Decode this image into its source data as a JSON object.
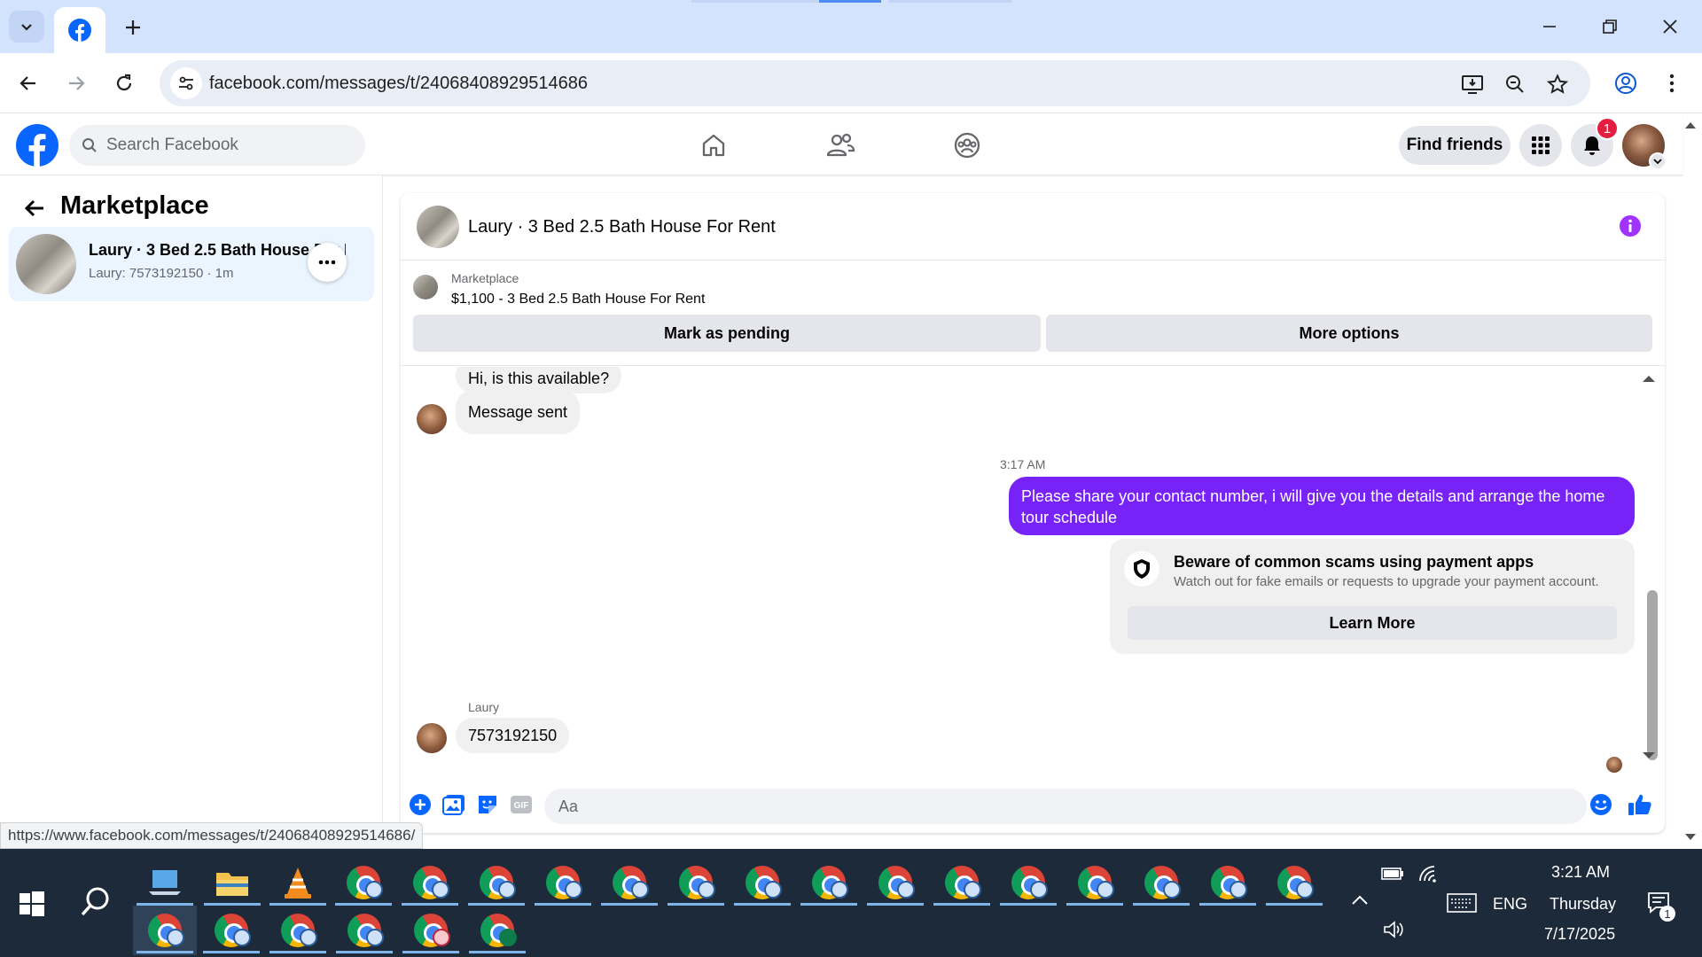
{
  "browser": {
    "url": "facebook.com/messages/t/24068408929514686",
    "status_url": "https://www.facebook.com/messages/t/24068408929514686/"
  },
  "fb_header": {
    "search_placeholder": "Search Facebook",
    "find_friends": "Find friends",
    "notification_count": "1"
  },
  "sidebar": {
    "title": "Marketplace",
    "conversation": {
      "title": "Laury · 3 Bed 2.5 Bath House For Rent",
      "subtitle": "Laury: 7573192150 · 1m"
    }
  },
  "chat": {
    "header_title": "Laury · 3 Bed 2.5 Bath House For Rent",
    "marketplace_label": "Marketplace",
    "listing": "$1,100 - 3 Bed 2.5 Bath House For Rent",
    "mark_pending": "Mark as pending",
    "more_options": "More options",
    "messages": {
      "first_incoming": "Hi, is this available?",
      "second_incoming": "Message sent",
      "timestamp": "3:17 AM",
      "outgoing": "Please share your contact number, i will give you the details and arrange the home tour schedule",
      "scam_title": "Beware of common scams using payment apps",
      "scam_text": "Watch out for fake emails or requests to upgrade your payment account.",
      "learn_more": "Learn More",
      "sender_name": "Laury",
      "reply": "7573192150"
    },
    "composer_placeholder": "Aa"
  },
  "taskbar": {
    "time": "3:21 AM",
    "day": "Thursday",
    "date": "7/17/2025",
    "language": "ENG",
    "notification_count": "1"
  },
  "colors": {
    "fb_blue": "#0866ff",
    "outgoing_bubble": "#7722f6",
    "info_purple": "#a033ff",
    "badge_red": "#e41e3f"
  }
}
